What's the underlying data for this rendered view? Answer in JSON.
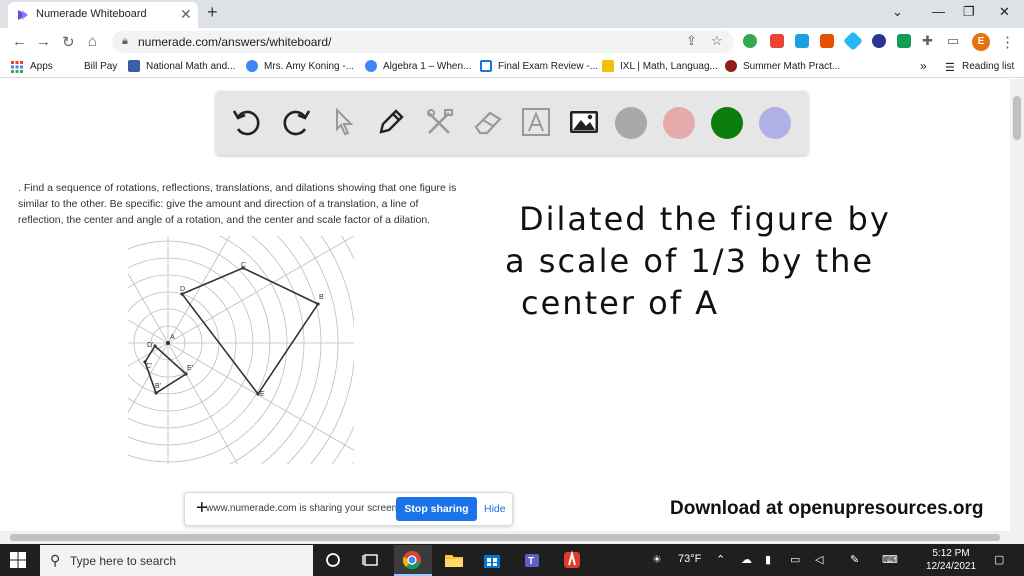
{
  "browser": {
    "tab_title": "Numerade Whiteboard",
    "tab_close": "✕",
    "new_tab": "+",
    "window_controls": [
      "⌄",
      "—",
      "❐",
      "✕"
    ],
    "url": "numerade.com/answers/whiteboard/"
  },
  "bookmarks": [
    {
      "label": "Apps",
      "icon_color": "#ea4335"
    },
    {
      "label": "Bill Pay",
      "icon_color": "#ffffff"
    },
    {
      "label": "National Math and...",
      "icon_color": "#3c5ba9"
    },
    {
      "label": "Mrs. Amy Koning -...",
      "icon_color": "#4285f4"
    },
    {
      "label": "Algebra 1 – When...",
      "icon_color": "#4285f4"
    },
    {
      "label": "Final Exam Review -...",
      "icon_color": "#1a73e8"
    },
    {
      "label": "IXL | Math, Languag...",
      "icon_color": "#f2c200"
    },
    {
      "label": "Summer Math Pract...",
      "icon_color": "#8e1e16"
    }
  ],
  "bookmarks_more": "»",
  "reading_list": "Reading list",
  "whiteboard": {
    "tools": [
      "undo-icon",
      "redo-icon",
      "pointer-icon",
      "pen-icon",
      "tools-icon",
      "eraser-icon",
      "text-icon",
      "image-icon"
    ],
    "colors": [
      "#a9a9a9",
      "#e7aaaa",
      "#0a7d0a",
      "#b0b0e6"
    ]
  },
  "question": ". Find a sequence of rotations, reflections, translations, and dilations showing that one figure is similar to the other. Be specific: give the amount and direction of a translation, a line of reflection, the center and angle of a rotation, and the center and scale factor of a dilation.",
  "figure_labels": {
    "C": "C",
    "D": "D",
    "B": "B",
    "A": "A",
    "E": "E",
    "D2": "D'",
    "C2": "C'",
    "B2": "B'",
    "E2": "E'"
  },
  "handwriting": {
    "line1": "Dilated the figure by",
    "line2": "a scale of 1/3 by the",
    "line3": "center of A"
  },
  "download_text": "Download at openupresources.org",
  "sharebar": {
    "message": "www.numerade.com is sharing your screen.",
    "stop_label": "Stop sharing",
    "hide_label": "Hide"
  },
  "taskbar": {
    "search_placeholder": "Type here to search",
    "weather": "73°F",
    "time": "5:12 PM",
    "date": "12/24/2021"
  }
}
